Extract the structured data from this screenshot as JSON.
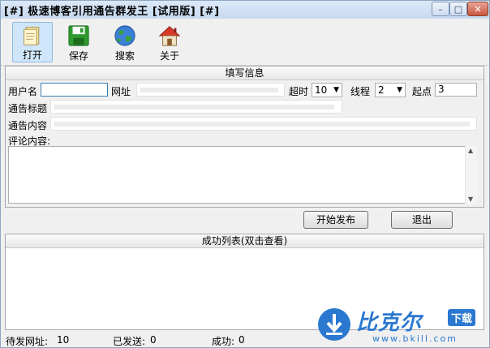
{
  "window": {
    "title": "[#] 极速博客引用通告群发王 [试用版] [#]",
    "controls": {
      "minimize": "–",
      "maximize": "□",
      "close": "✕"
    }
  },
  "toolbar": {
    "items": [
      {
        "label": "打开",
        "icon": "open-document-icon"
      },
      {
        "label": "保存",
        "icon": "floppy-disk-icon"
      },
      {
        "label": "搜索",
        "icon": "globe-icon"
      },
      {
        "label": "关于",
        "icon": "home-icon"
      }
    ]
  },
  "form": {
    "section_title": "填写信息",
    "username_label": "用户名",
    "username_value": "",
    "url_label": "网址",
    "timeout_label": "超时",
    "timeout_value": "10",
    "threads_label": "线程",
    "threads_value": "2",
    "start_label": "起点",
    "start_value": "3",
    "notice_title_label": "通告标题",
    "notice_content_label": "通告内容",
    "comment_label": "评论内容:",
    "comment_value": ""
  },
  "actions": {
    "start_publish": "开始发布",
    "exit": "退出"
  },
  "results": {
    "title": "成功列表(双击查看)"
  },
  "status": {
    "pending_label": "待发网址:",
    "pending_value": "10",
    "sent_label": "已发送:",
    "sent_value": "0",
    "success_label": "成功:",
    "success_value": "0"
  },
  "watermark": {
    "brand": "比克尔",
    "badge": "下载",
    "url": "www.bkill.com"
  }
}
